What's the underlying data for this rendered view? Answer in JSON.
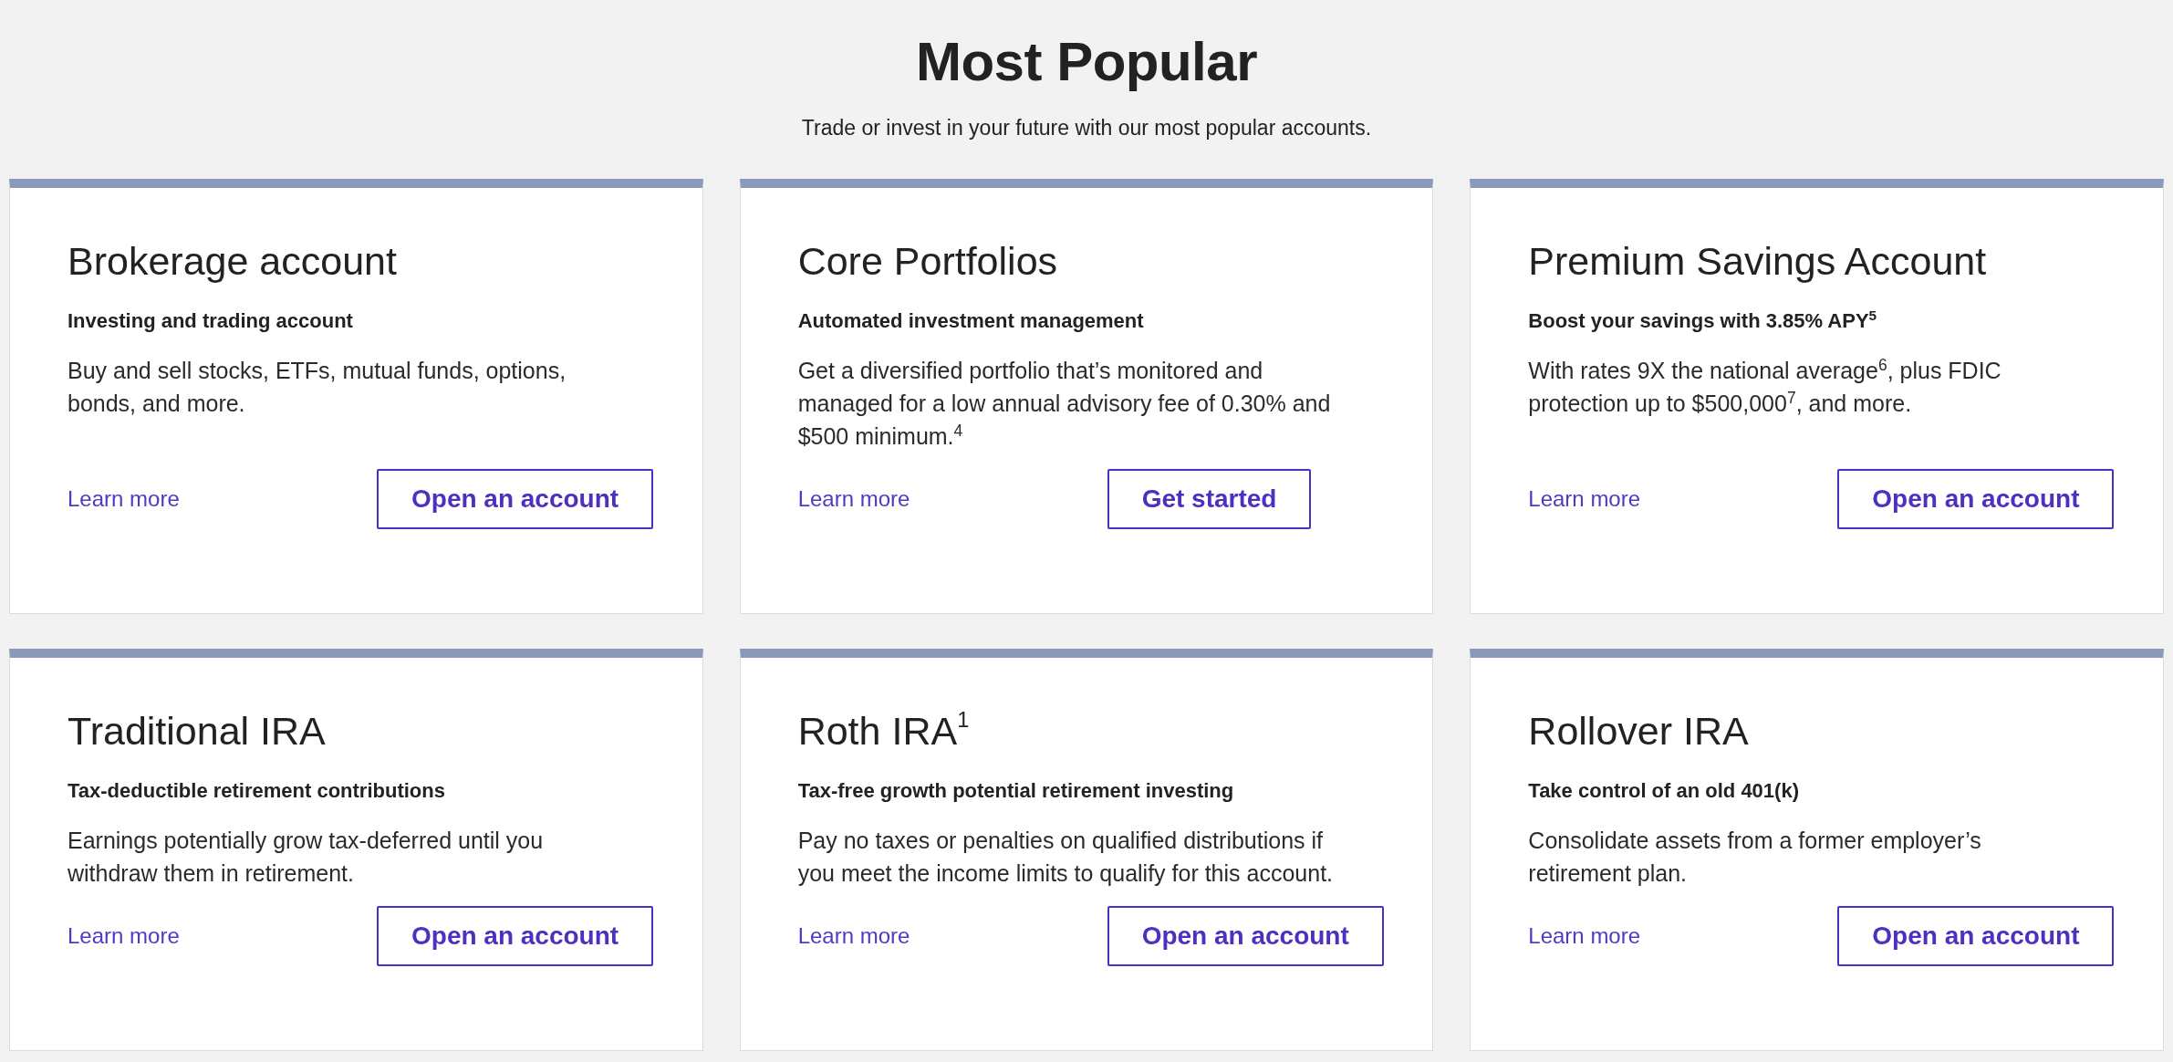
{
  "header": {
    "title": "Most Popular",
    "subtitle": "Trade or invest in your future with our most popular accounts."
  },
  "cards": [
    {
      "title": "Brokerage account",
      "subtitle": "Investing and trading account",
      "description": "Buy and sell stocks, ETFs, mutual funds, options, bonds, and more.",
      "link": "Learn more",
      "button": "Open an account"
    },
    {
      "title": "Core Portfolios",
      "subtitle": "Automated investment management",
      "description": "Get a diversified portfolio that’s monitored and managed for a low annual advisory fee of 0.30% and $500 minimum.$^{4}$",
      "link": "Learn more",
      "button": "Get started"
    },
    {
      "title": "Premium Savings Account",
      "subtitle": "Boost your savings with 3.85% APY$^{5}$",
      "description": "With rates 9X the national average$^{6}$, plus FDIC protection up to $500,000$^{7}$, and more.",
      "link": "Learn more",
      "button": "Open an account"
    },
    {
      "title": "Traditional IRA",
      "subtitle": "Tax-deductible retirement contributions",
      "description": "Earnings potentially grow tax-deferred until you withdraw them in retirement.",
      "link": "Learn more",
      "button": "Open an account"
    },
    {
      "title": "Roth IRA$^{1}$",
      "subtitle": "Tax-free growth potential retirement investing",
      "description": "Pay no taxes or penalties on qualified distributions if you meet the income limits to qualify for this account.",
      "link": "Learn more",
      "button": "Open an account"
    },
    {
      "title": "Rollover IRA",
      "subtitle": "Take control of an old 401(k)",
      "description": "Consolidate assets from a former employer’s retirement plan.",
      "link": "Learn more",
      "button": "Open an account"
    }
  ]
}
